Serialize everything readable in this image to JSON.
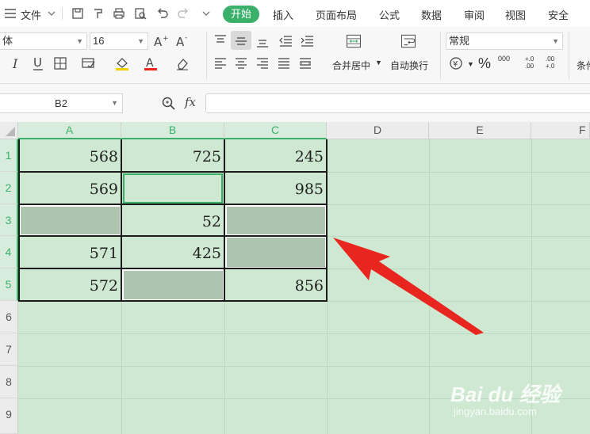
{
  "menu": {
    "file_label": "文件",
    "tabs": [
      "开始",
      "插入",
      "页面布局",
      "公式",
      "数据",
      "审阅",
      "视图",
      "安全"
    ]
  },
  "ribbon": {
    "font_name": "体",
    "font_size": "16",
    "number_format": "常规",
    "merge_label": "合并居中",
    "wrap_label": "自动换行",
    "cond_label": "条件",
    "percent": "%",
    "thousand": "000",
    "dec_inc": "+.0 .00",
    "dec_dec": ".00 +.0"
  },
  "formula_bar": {
    "cell_ref": "B2",
    "fx": "fx",
    "value": ""
  },
  "grid": {
    "columns": [
      "A",
      "B",
      "C",
      "D",
      "E",
      "F"
    ],
    "rows": [
      "1",
      "2",
      "3",
      "4",
      "5",
      "6",
      "7",
      "8",
      "9"
    ],
    "cells": {
      "A1": "568",
      "B1": "725",
      "C1": "245",
      "A2": "569",
      "B2": "",
      "C2": "985",
      "A3": "",
      "B3": "52",
      "C3": "",
      "A4": "571",
      "B4": "425",
      "C4": "",
      "A5": "572",
      "B5": "",
      "C5": "856"
    },
    "active_cell": "B2"
  },
  "watermark": {
    "logo": "Bai du 经验",
    "url": "jingyan.baidu.com"
  },
  "colors": {
    "accent": "#3ab06a",
    "sheet_bg": "#cfe8d2",
    "empty_cell": "#adc4ae",
    "arrow": "#e8261f"
  }
}
